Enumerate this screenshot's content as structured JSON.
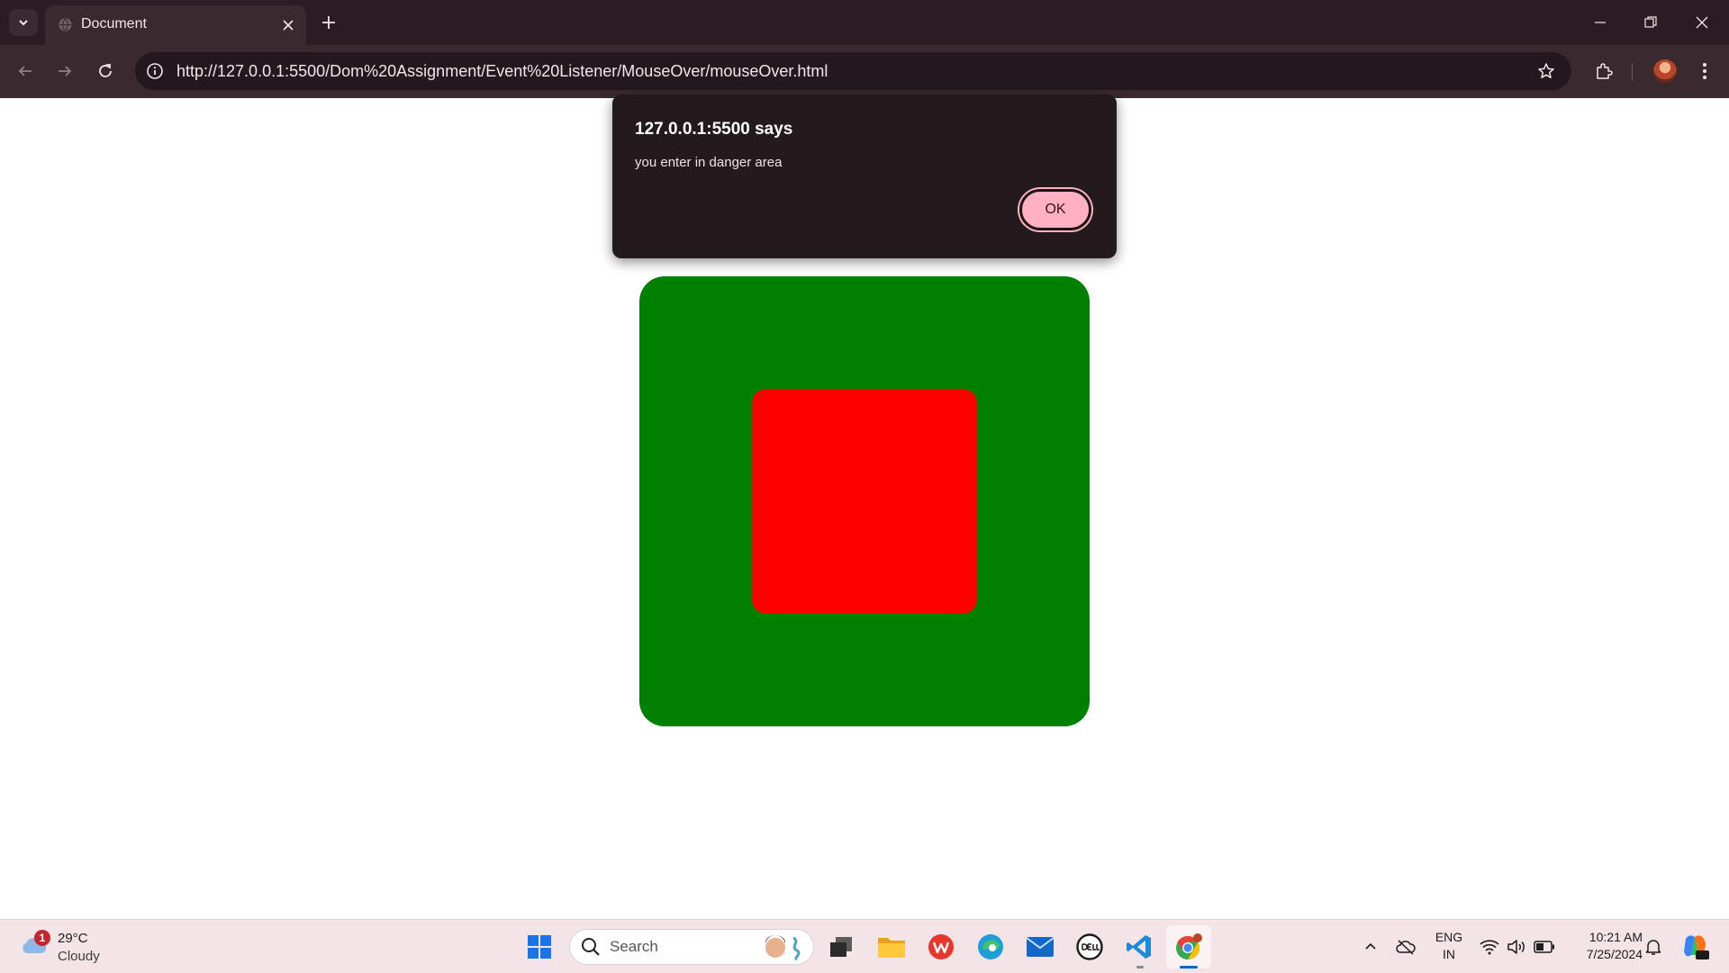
{
  "browser": {
    "tab": {
      "title": "Document"
    },
    "address_bar": {
      "url": "http://127.0.0.1:5500/Dom%20Assignment/Event%20Listener/MouseOver/mouseOver.html"
    },
    "colors": {
      "frame": "#2a1c22",
      "toolbar": "#3a2a30"
    }
  },
  "page": {
    "outer_box": {
      "color": "#008000"
    },
    "inner_box": {
      "color": "#ff0000"
    }
  },
  "alert": {
    "title": "127.0.0.1:5500 says",
    "message": "you enter in danger area",
    "ok_label": "OK",
    "ok_color": "#ffb1c1"
  },
  "taskbar": {
    "weather": {
      "badge": "1",
      "temperature": "29°C",
      "condition": "Cloudy"
    },
    "search": {
      "label": "Search"
    },
    "apps": [
      "start-icon",
      "task-view-icon",
      "file-explorer-icon",
      "wps-office-icon",
      "edge-icon",
      "mail-icon",
      "dell-icon",
      "vscode-icon",
      "chrome-icon"
    ],
    "tray": {
      "language": "ENG",
      "region": "IN",
      "time": "10:21 AM",
      "date": "7/25/2024"
    }
  }
}
